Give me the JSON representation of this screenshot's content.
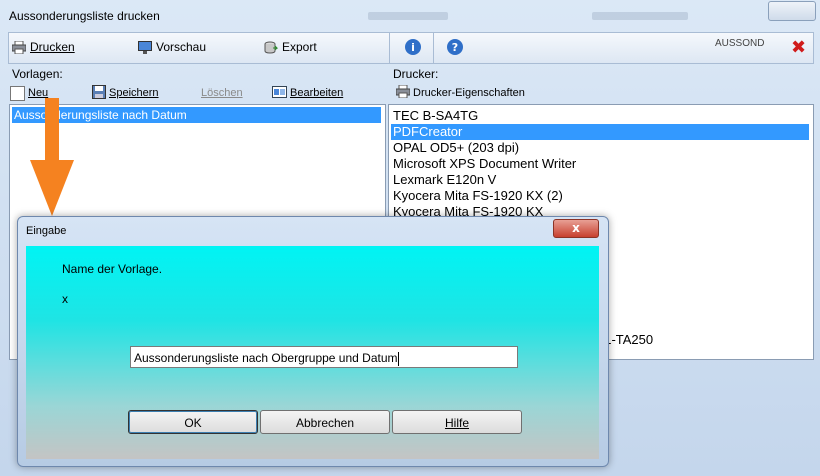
{
  "window": {
    "title": "Aussonderungsliste drucken"
  },
  "toolbar": {
    "print_label": "Drucken",
    "preview_label": "Vorschau",
    "export_label": "Export",
    "info_glyph": "i",
    "help_glyph": "?",
    "code": "AUSSOND"
  },
  "templates": {
    "label": "Vorlagen:",
    "new_label": "Neu",
    "save_label": "Speichern",
    "delete_label": "Löschen",
    "edit_label": "Bearbeiten",
    "items": [
      "Aussonderungsliste nach Datum"
    ]
  },
  "printers": {
    "label": "Drucker:",
    "properties_label": "Drucker-Eigenschaften",
    "items": [
      "TEC B-SA4TG",
      "PDFCreator",
      "OPAL OD5+ (203 dpi)",
      "Microsoft XPS Document Writer",
      "Lexmark E120n V",
      "Kyocera Mita FS-1920 KX (2)",
      "Kyocera Mita FS-1920 KX"
    ],
    "selected_index": 1,
    "partial_item": "01-TA250"
  },
  "dialog": {
    "title": "Eingabe",
    "close_glyph": "x",
    "prompt": "Name der Vorlage.",
    "detail": "x",
    "input_value": "Aussonderungsliste nach Obergruppe und Datum",
    "ok_label": "OK",
    "cancel_label": "Abbrechen",
    "help_label": "Hilfe"
  },
  "colors": {
    "arrow": "#f58220",
    "selection": "#3399ff",
    "dialog_client": "#00f0f0",
    "close_red": "#d01b1b"
  }
}
